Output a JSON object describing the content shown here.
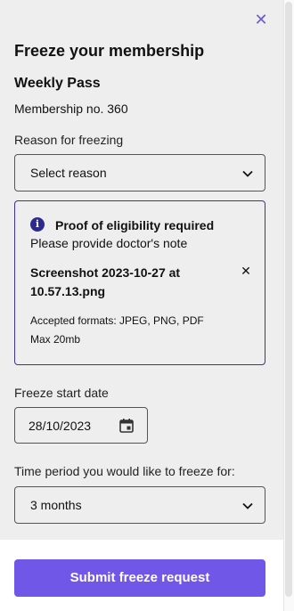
{
  "header": {
    "title": "Freeze your membership",
    "close_label": "✕"
  },
  "membership": {
    "pass_name": "Weekly Pass",
    "number": "Membership no. 360"
  },
  "reason": {
    "label": "Reason for freezing",
    "selected": "Select reason"
  },
  "eligibility": {
    "title": "Proof of eligibility required",
    "description": "Please provide doctor's note",
    "file_name": "Screenshot 2023-10-27 at 10.57.13.png",
    "remove_label": "✕",
    "accepted_formats": "Accepted formats: JPEG, PNG, PDF",
    "max_size": "Max 20mb"
  },
  "start_date": {
    "label": "Freeze start date",
    "value": "28/10/2023"
  },
  "period": {
    "label": "Time period you would like to freeze for:",
    "selected": "3 months"
  },
  "actions": {
    "submit_label": "Submit freeze request"
  },
  "colors": {
    "accent": "#7157e8",
    "info": "#2c2a8f",
    "panel_bg": "#eeeeee"
  }
}
